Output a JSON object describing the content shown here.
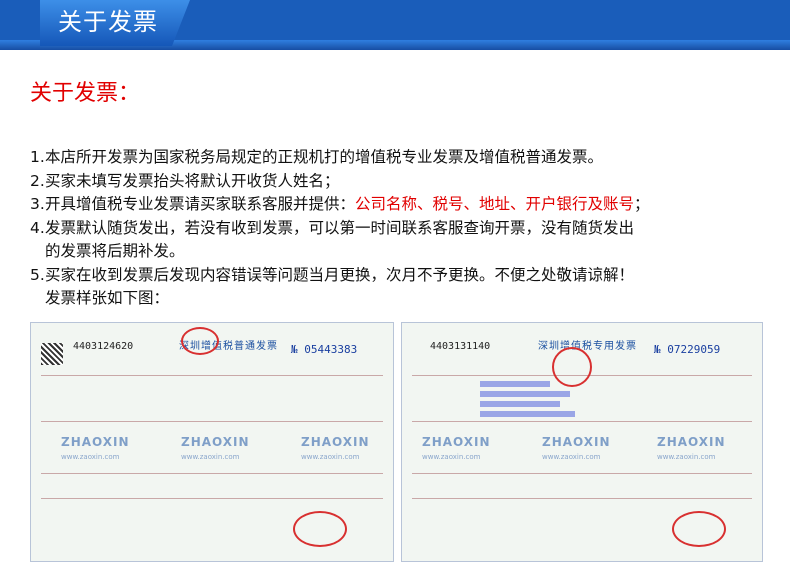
{
  "header": {
    "tab_label": "关于发票"
  },
  "section": {
    "title": "关于发票："
  },
  "items": [
    {
      "num": "1.",
      "text": "本店所开发票为国家税务局规定的正规机打的增值税专业发票及增值税普通发票。"
    },
    {
      "num": "2.",
      "text": "买家未填写发票抬头将默认开收货人姓名；"
    },
    {
      "num": "3.",
      "text": "开具增值税专业发票请买家联系客服并提供：",
      "highlight": "公司名称、税号、地址、开户银行及账号",
      "tail": "；"
    },
    {
      "num": "4.",
      "text": "发票默认随货发出，若没有收到发票，可以第一时间联系客服查询开票，没有随货发出",
      "cont": "的发票将后期补发。"
    },
    {
      "num": "5.",
      "text": "买家在收到发票后发现内容错误等问题当月更换，次月不予更换。不便之处敬请谅解！",
      "cont": "发票样张如下图："
    }
  ],
  "sample_left": {
    "code": "4403124620",
    "title": "深圳增值税普通发票",
    "number": "№ 05443383",
    "watermark": "ZHAOXIN",
    "site": "www.zaoxin.com"
  },
  "sample_right": {
    "code": "4403131140",
    "title": "深圳增值税专用发票",
    "number": "№ 07229059",
    "watermark": "ZHAOXIN",
    "site": "www.zaoxin.com"
  },
  "colors": {
    "header": "#1a5dba",
    "accent_red": "#e10000"
  }
}
